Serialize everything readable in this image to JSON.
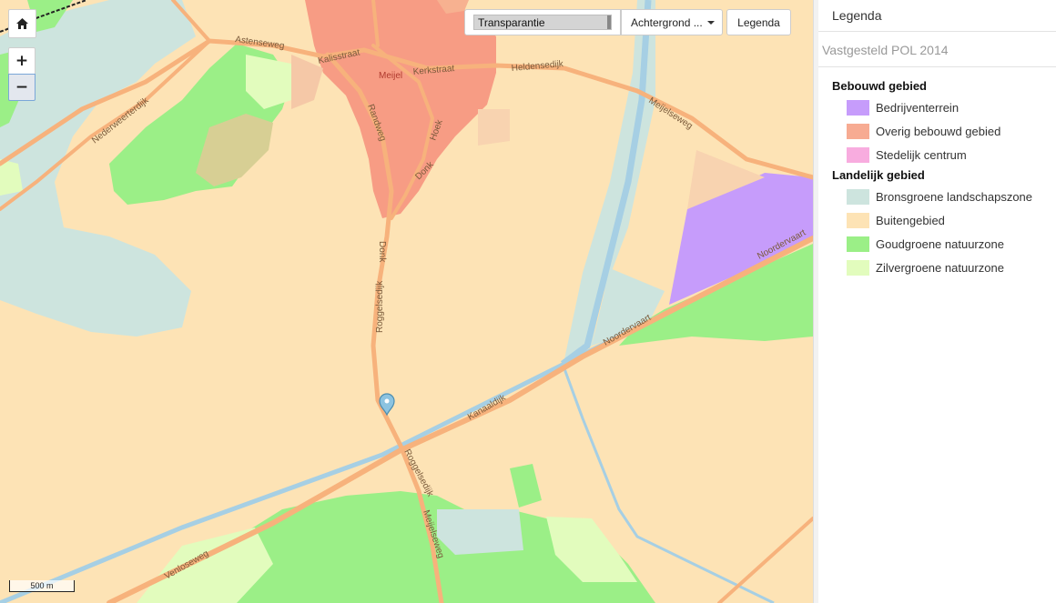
{
  "map": {
    "colors": {
      "buitengebied": "#fde3b5",
      "bronsgroen": "#cde4de",
      "goudgroen": "#9bef87",
      "zilvergroen": "#e2fcbd",
      "bebouwd": "#f79c84",
      "bedrijven": "#c69cfb",
      "road": "#f7b27c",
      "water": "#a6cfe4"
    },
    "labels": {
      "astenseweg": "Astenseweg",
      "kalisstraat": "Kalisstraat",
      "meijel": "Meijel",
      "kerkstraat": "Kerkstraat",
      "heldensedijk": "Heldensedijk",
      "nederweerterdijk": "Nederweerterdijk",
      "randweg": "Randweg",
      "hoek": "Hoek",
      "donk1": "Donk",
      "donk2": "Donk",
      "meijelseweg_ne": "Meijelseweg",
      "roggelsedijk1": "Roggelsedijk",
      "roggelsedijk2": "Roggelsedijk",
      "meijelseweg_s": "Meijelseweg",
      "noordervaart1": "Noordervaart",
      "noordervaart2": "Noordervaart",
      "kanaaldijk": "Kanaaldijk",
      "venloseweg": "Venloseweg"
    },
    "scalebar": "500 m"
  },
  "controls": {
    "home_icon": "home-icon",
    "zoom_in": "+",
    "zoom_out": "−"
  },
  "toolbar": {
    "transparency_label": "Transparantie",
    "background_label": "Achtergrond ...",
    "legend_label": "Legenda"
  },
  "legend": {
    "title": "Legenda",
    "layer": "Vastgesteld POL 2014",
    "groups": [
      {
        "title": "Bebouwd gebied",
        "items": [
          {
            "label": "Bedrijventerrein",
            "color": "#c69cfb"
          },
          {
            "label": "Overig bebouwd gebied",
            "color": "#f7ab92"
          },
          {
            "label": "Stedelijk centrum",
            "color": "#f8acdf"
          }
        ]
      },
      {
        "title": "Landelijk gebied",
        "items": [
          {
            "label": "Bronsgroene landschapszone",
            "color": "#cde4de"
          },
          {
            "label": "Buitengebied",
            "color": "#fde3b5"
          },
          {
            "label": "Goudgroene natuurzone",
            "color": "#9bef87"
          },
          {
            "label": "Zilvergroene natuurzone",
            "color": "#e2fcbd"
          }
        ]
      }
    ]
  }
}
